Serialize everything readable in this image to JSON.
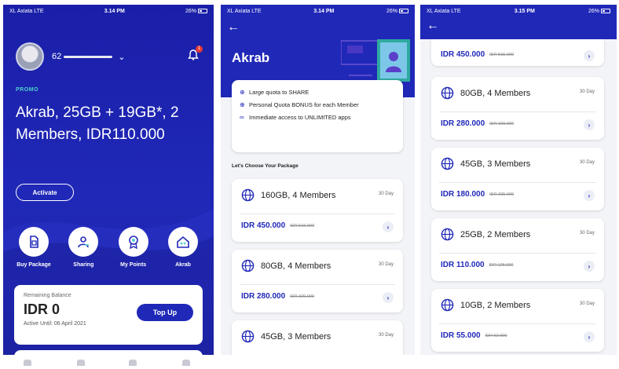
{
  "status_bars": [
    {
      "carrier": "XL Axiata  LTE",
      "time": "3.14 PM",
      "battery": "26%"
    },
    {
      "carrier": "XL Axiata  LTE",
      "time": "3.14 PM",
      "battery": "26%"
    },
    {
      "carrier": "XL Axiata  LTE",
      "time": "3.15 PM",
      "battery": "26%"
    }
  ],
  "home": {
    "phone_prefix": "62",
    "notification_count": "1",
    "promo_tag": "PROMO",
    "promo_title": "Akrab, 25GB + 19GB*, 2 Members, IDR110.000",
    "activate_label": "Activate",
    "menu": [
      {
        "label": "Buy Package",
        "icon": "sim-card-icon"
      },
      {
        "label": "Sharing",
        "icon": "sharing-icon"
      },
      {
        "label": "My Points",
        "icon": "medal-icon"
      },
      {
        "label": "Akrab",
        "icon": "family-home-icon"
      }
    ],
    "balance": {
      "label": "Remaining Balance",
      "value": "IDR 0",
      "active_until": "Active Until: 06 April 2021",
      "topup_label": "Top Up"
    }
  },
  "akrab": {
    "title": "Akrab",
    "benefits": [
      {
        "icon": "globe-icon",
        "text": "Large quota to SHARE"
      },
      {
        "icon": "globe-icon",
        "text": "Personal Quota BONUS for each Member"
      },
      {
        "icon": "infinity-icon",
        "text": "Immediate access to UNLIMITED apps"
      }
    ],
    "choose_label": "Let's Choose Your Package",
    "packages": [
      {
        "name": "160GB, 4 Members",
        "days": "30 Day",
        "price": "IDR 450.000",
        "old_price": "IDR 515.000"
      },
      {
        "name": "80GB, 4 Members",
        "days": "30 Day",
        "price": "IDR 280.000",
        "old_price": "IDR 320.000"
      },
      {
        "name": "45GB, 3 Members",
        "days": "30 Day",
        "price": "",
        "old_price": ""
      }
    ]
  },
  "list": {
    "partial_top": {
      "price": "IDR 450.000",
      "old_price": "IDR 515.000"
    },
    "packages": [
      {
        "name": "80GB, 4 Members",
        "days": "30 Day",
        "price": "IDR 280.000",
        "old_price": "IDR 320.000"
      },
      {
        "name": "45GB, 3 Members",
        "days": "30 Day",
        "price": "IDR 180.000",
        "old_price": "IDR 205.000"
      },
      {
        "name": "25GB, 2 Members",
        "days": "30 Day",
        "price": "IDR 110.000",
        "old_price": "IDR 125.000"
      },
      {
        "name": "10GB, 2 Members",
        "days": "30 Day",
        "price": "IDR 55.000",
        "old_price": "IDR 62.000"
      }
    ]
  },
  "colors": {
    "primary": "#2028b8",
    "accent": "#4fd3c8",
    "background": "#f3f4f8"
  }
}
